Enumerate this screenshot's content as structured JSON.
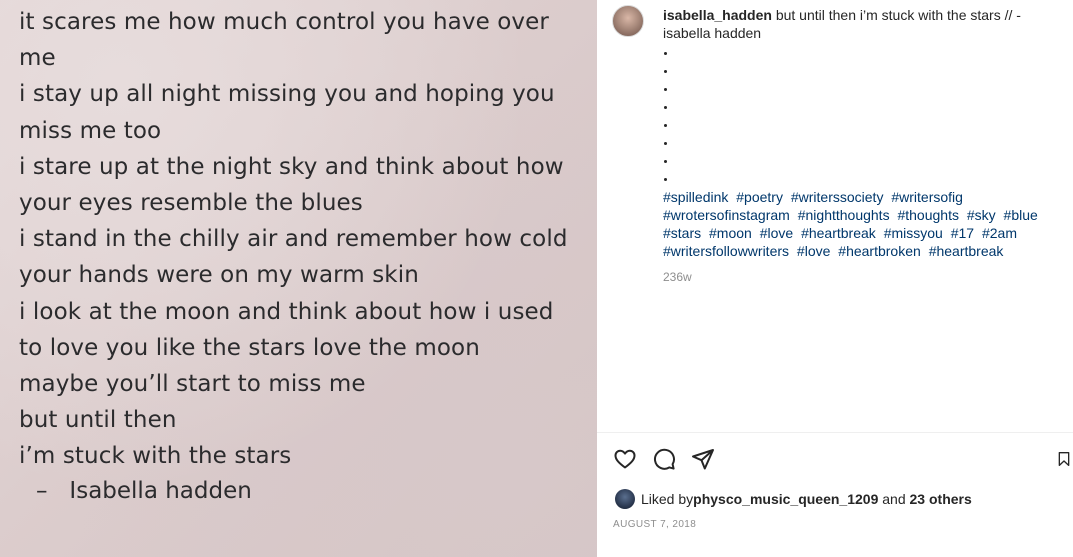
{
  "poem": {
    "lines": [
      "it scares me how much control you have over",
      "me",
      "i stay up all night missing you and hoping you",
      "miss me too",
      "i stare up at the night sky and think about how",
      "your eyes resemble the blues",
      "i stand in the chilly air and remember how cold",
      "your hands were on my warm skin",
      "i look at the moon and think about how i used",
      "to love you like the stars love the moon",
      "maybe you’ll start to miss me",
      "but until then",
      "i’m stuck with the stars"
    ],
    "signature": "–   Isabella hadden"
  },
  "post": {
    "username": "isabella_hadden",
    "caption_text": "but until then i’m stuck with the stars // - isabella hadden",
    "bullet_count": 8,
    "hashtags": [
      "#spilledink",
      "#poetry",
      "#writerssociety",
      "#writersofig",
      "#wrotersofinstagram",
      "#nightthoughts",
      "#thoughts",
      "#sky",
      "#blue",
      "#stars",
      "#moon",
      "#love",
      "#heartbreak",
      "#missyou",
      "#17",
      "#2am",
      "#writersfollowwriters",
      "#love",
      "#heartbroken",
      "#heartbreak"
    ],
    "time_ago": "236w",
    "likes": {
      "prefix": "Liked by ",
      "user": "physco_music_queen_1209",
      "middle": " and ",
      "others": "23 others"
    },
    "date": "AUGUST 7, 2018"
  },
  "icons": {
    "like": "heart-icon",
    "comment": "comment-icon",
    "share": "send-icon",
    "save": "bookmark-icon"
  },
  "colors": {
    "text": "#262626",
    "hashtag": "#00376b",
    "muted": "#8e8e8e",
    "poem_text": "#2b2b2d"
  }
}
